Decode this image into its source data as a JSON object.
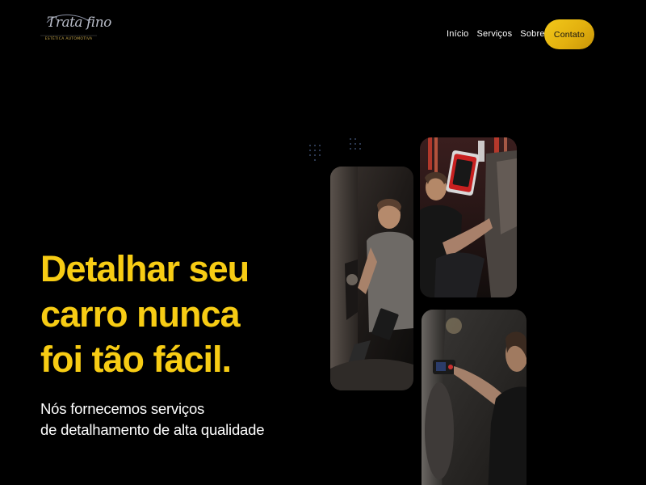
{
  "brand": {
    "logo_text": "Trata fino",
    "tagline": "ESTÉTICA AUTOMOTIVA"
  },
  "nav": {
    "links": [
      "Início",
      "Serviços",
      "Sobre"
    ],
    "cta_label": "Contato"
  },
  "hero": {
    "headline_lines": [
      "Detalhar seu",
      "carro nunca",
      "foi tão fácil."
    ],
    "subhead_lines": [
      "Nós fornecemos serviços",
      "de detalhamento de alta qualidade"
    ]
  },
  "colors": {
    "background": "#000000",
    "accent": "#f7cc14",
    "text": "#ffffff"
  }
}
